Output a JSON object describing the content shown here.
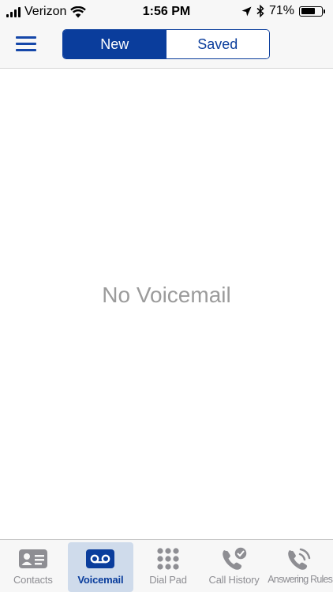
{
  "status_bar": {
    "carrier": "Verizon",
    "time": "1:56 PM",
    "battery_percent": "71%",
    "battery_level": 0.71,
    "icons": [
      "signal-icon",
      "wifi-icon",
      "location-arrow-icon",
      "bluetooth-icon",
      "battery-icon"
    ]
  },
  "nav": {
    "menu_icon": "hamburger-menu-icon",
    "segments": [
      {
        "label": "New",
        "selected": true
      },
      {
        "label": "Saved",
        "selected": false
      }
    ]
  },
  "main": {
    "empty_message": "No Voicemail"
  },
  "tab_bar": {
    "active_color": "#0a3d9c",
    "inactive_color": "#8e8e93",
    "tabs": [
      {
        "label": "Contacts",
        "icon": "contact-card-icon",
        "active": false
      },
      {
        "label": "Voicemail",
        "icon": "voicemail-icon",
        "active": true
      },
      {
        "label": "Dial Pad",
        "icon": "dialpad-icon",
        "active": false
      },
      {
        "label": "Call History",
        "icon": "call-history-icon",
        "active": false
      },
      {
        "label": "Answering Rules",
        "icon": "answering-rules-icon",
        "active": false
      }
    ]
  }
}
